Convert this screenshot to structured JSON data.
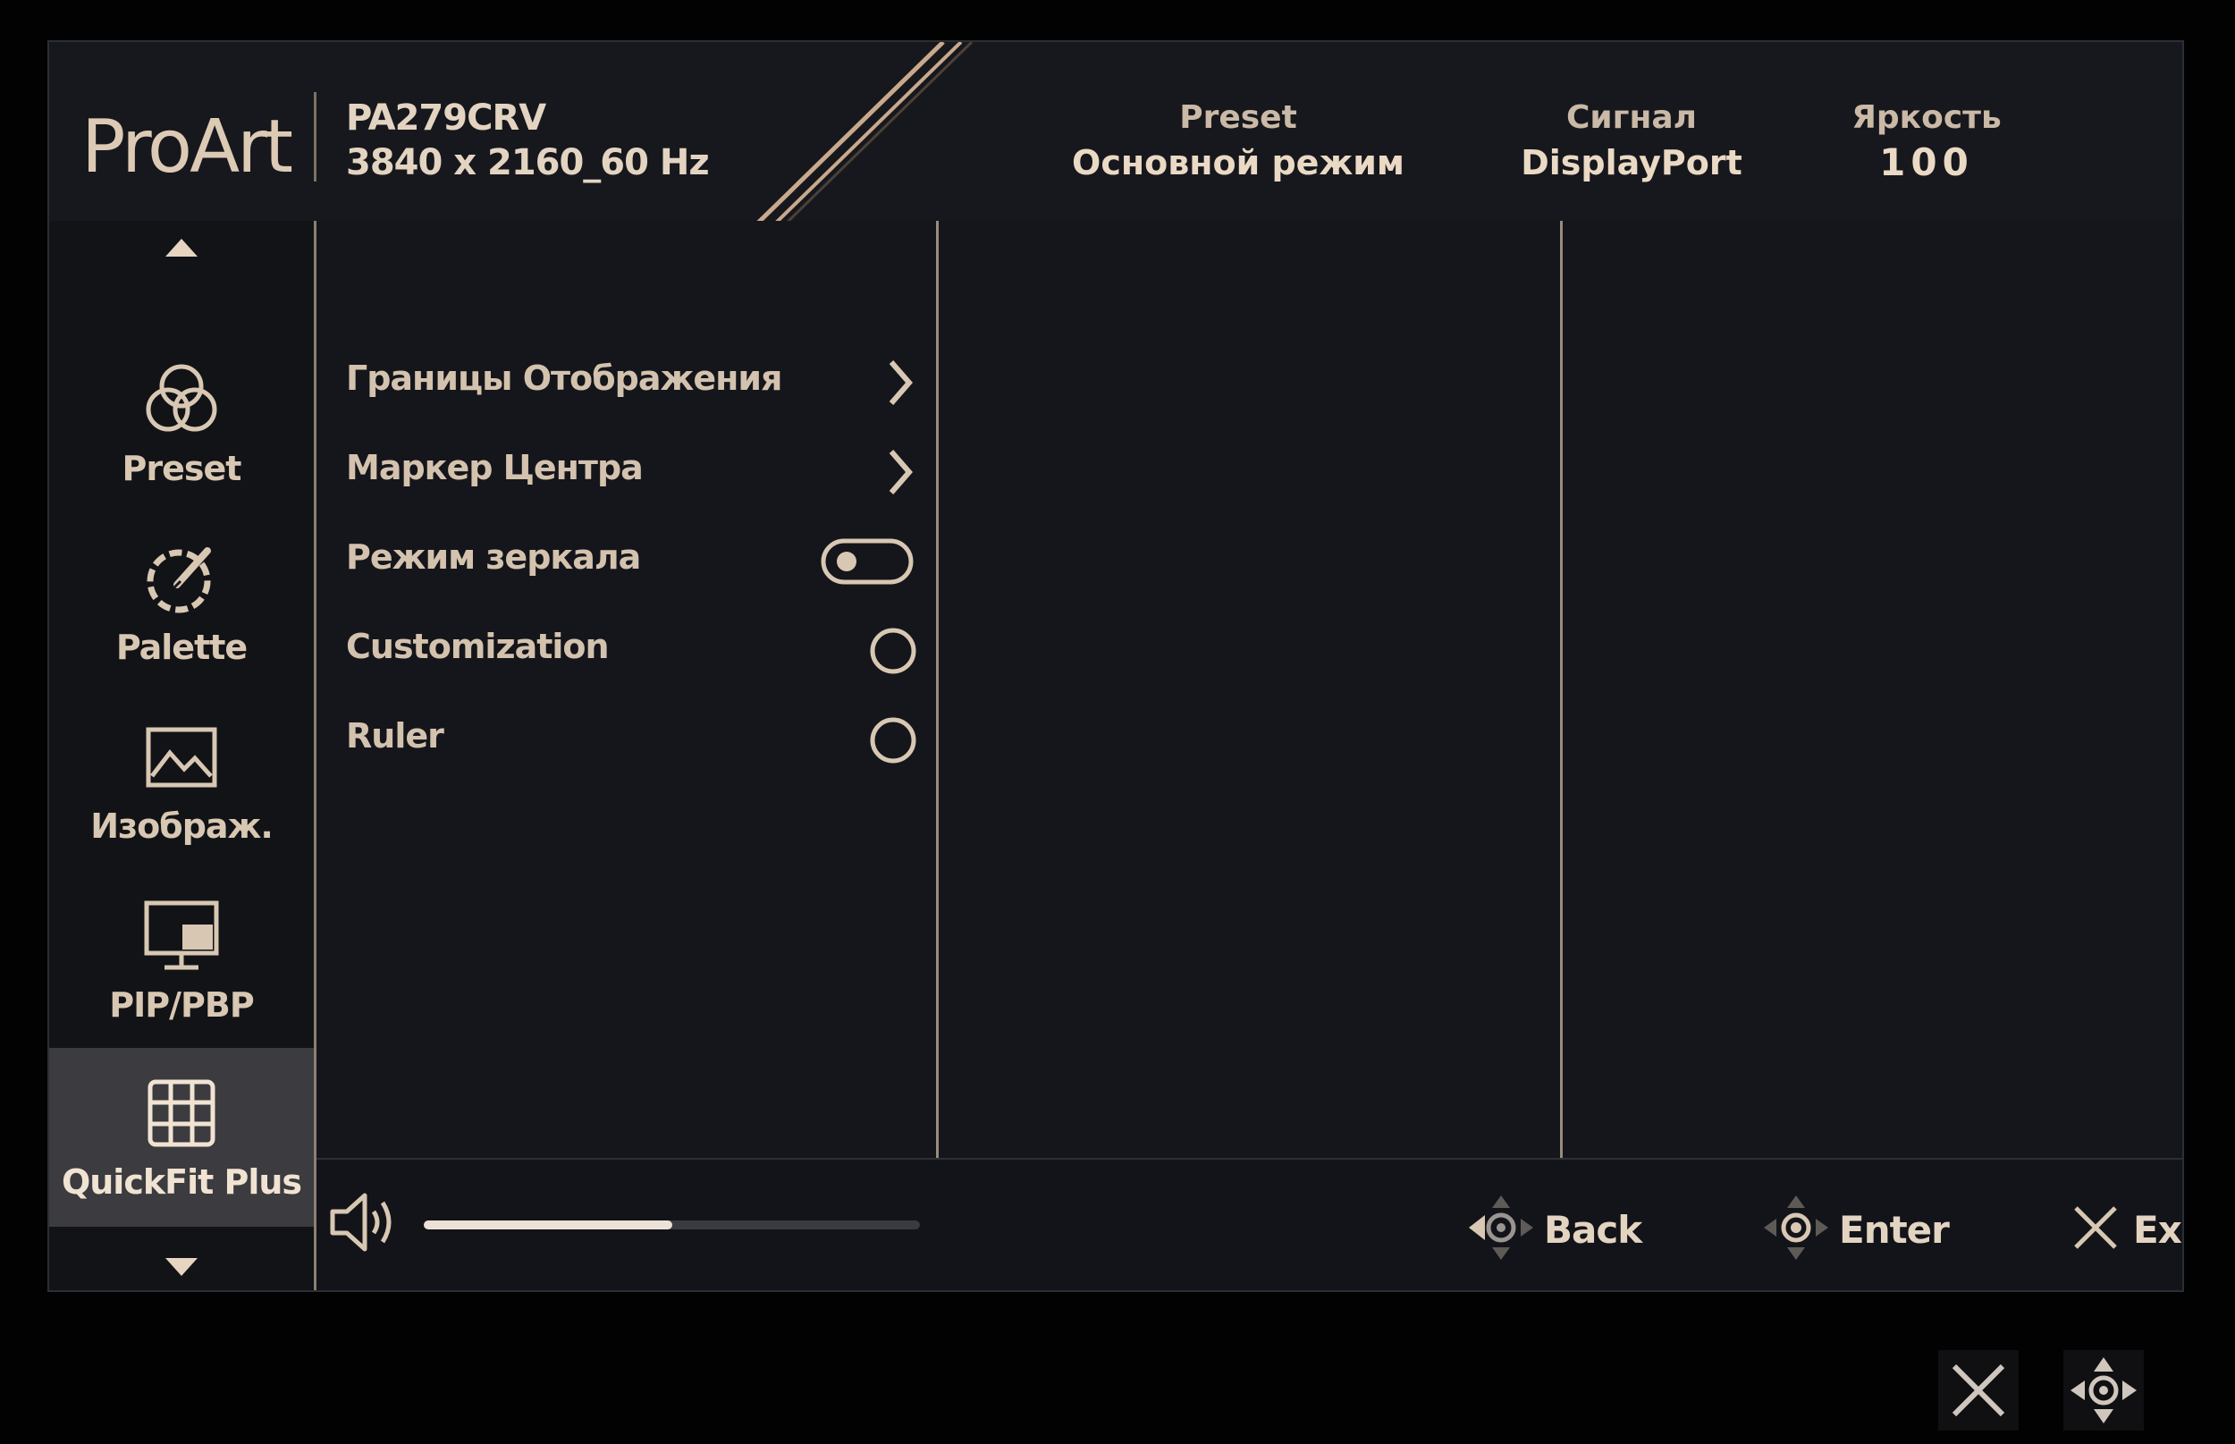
{
  "header": {
    "brand": "ProArt",
    "model": "PA279CRV",
    "resolution": "3840 x 2160_60 Hz",
    "preset_label": "Preset",
    "preset_value": "Основной режим",
    "signal_label": "Сигнал",
    "signal_value": "DisplayPort",
    "brightness_label": "Яркость",
    "brightness_value": "100"
  },
  "sidebar": {
    "items": [
      {
        "label": "Preset",
        "icon": "preset-rings-icon",
        "active": false
      },
      {
        "label": "Palette",
        "icon": "palette-icon",
        "active": false
      },
      {
        "label": "Изображ.",
        "icon": "image-icon",
        "active": false
      },
      {
        "label": "PIP/PBP",
        "icon": "pip-monitor-icon",
        "active": false
      },
      {
        "label": "QuickFit Plus",
        "icon": "grid-icon",
        "active": true
      }
    ]
  },
  "menu": {
    "items": [
      {
        "label": "Границы Отображения",
        "control": "chevron"
      },
      {
        "label": "Маркер Центра",
        "control": "chevron"
      },
      {
        "label": "Режим зеркала",
        "control": "toggle",
        "on": false
      },
      {
        "label": "Customization",
        "control": "radio",
        "selected": false
      },
      {
        "label": "Ruler",
        "control": "radio",
        "selected": false
      }
    ]
  },
  "footer": {
    "volume_level": 0.5,
    "back_label": "Back",
    "enter_label": "Enter",
    "exit_label": "Exit"
  },
  "colors": {
    "accent": "#d9c9b6",
    "background": "#15161b",
    "divider": "#9a8b7c",
    "active_tab": "#3b3b40"
  }
}
